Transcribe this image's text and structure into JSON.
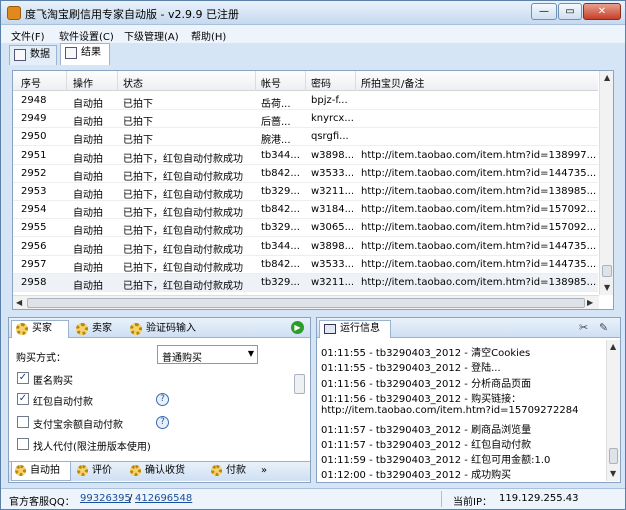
{
  "window": {
    "title": "度飞淘宝刷信用专家自动版 - v2.9.9 已注册",
    "minimize": "—",
    "restore": "▭",
    "close": "✕"
  },
  "menu": [
    "文件(F)",
    "软件设置(C)",
    "下级管理(A)",
    "帮助(H)"
  ],
  "top_tabs": [
    "数据",
    "结果"
  ],
  "grid": {
    "headers": [
      "序号",
      "操作",
      "状态",
      "帐号",
      "密码",
      "所拍宝贝/备注"
    ],
    "rows": [
      [
        "2948",
        "自动拍",
        "已拍下",
        "岳荷...",
        "bpjz-f...",
        ""
      ],
      [
        "2949",
        "自动拍",
        "已拍下",
        "后蔷...",
        "knyrcx...",
        ""
      ],
      [
        "2950",
        "自动拍",
        "已拍下",
        "腕港...",
        "qsrgfi...",
        ""
      ],
      [
        "2951",
        "自动拍",
        "已拍下，红包自动付款成功",
        "tb344...",
        "w3898...",
        "http://item.taobao.com/item.htm?id=138997..."
      ],
      [
        "2952",
        "自动拍",
        "已拍下，红包自动付款成功",
        "tb842...",
        "w3533...",
        "http://item.taobao.com/item.htm?id=144735..."
      ],
      [
        "2953",
        "自动拍",
        "已拍下，红包自动付款成功",
        "tb329...",
        "w3211...",
        "http://item.taobao.com/item.htm?id=138985..."
      ],
      [
        "2954",
        "自动拍",
        "已拍下，红包自动付款成功",
        "tb842...",
        "w3184...",
        "http://item.taobao.com/item.htm?id=157092..."
      ],
      [
        "2955",
        "自动拍",
        "已拍下，红包自动付款成功",
        "tb329...",
        "w3065...",
        "http://item.taobao.com/item.htm?id=157092..."
      ],
      [
        "2956",
        "自动拍",
        "已拍下，红包自动付款成功",
        "tb344...",
        "w3898...",
        "http://item.taobao.com/item.htm?id=144735..."
      ],
      [
        "2957",
        "自动拍",
        "已拍下，红包自动付款成功",
        "tb842...",
        "w3533...",
        "http://item.taobao.com/item.htm?id=144735..."
      ],
      [
        "2958",
        "自动拍",
        "已拍下，红包自动付款成功",
        "tb329...",
        "w3211...",
        "http://item.taobao.com/item.htm?id=138985..."
      ]
    ]
  },
  "left_panel": {
    "tabs": [
      "买家",
      "卖家",
      "验证码输入"
    ],
    "buy_method_label": "购买方式：",
    "buy_method_value": "普通购买",
    "options": [
      {
        "label": "匿名购买",
        "checked": true,
        "help": false
      },
      {
        "label": "红包自动付款",
        "checked": true,
        "help": true
      },
      {
        "label": "支付宝余额自动付款",
        "checked": false,
        "help": true
      },
      {
        "label": "找人代付(限注册版本使用)",
        "checked": false,
        "help": false
      }
    ],
    "bottom_tabs": [
      "自动拍",
      "评价",
      "确认收货",
      "付款"
    ],
    "more": "»"
  },
  "right_panel": {
    "title": "运行信息",
    "log": [
      "01:11:55 - tb3290403_2012 - 清空Cookies",
      "01:11:55 - tb3290403_2012 - 登陆...",
      "01:11:56 - tb3290403_2012 - 分析商品页面",
      "01:11:56 - tb3290403_2012 - 购买链接：",
      "http://item.taobao.com/item.htm?id=15709272284",
      "01:11:57 - tb3290403_2012 - 刷商品浏览量",
      "01:11:57 - tb3290403_2012 - 红包自动付款",
      "01:11:59 - tb3290403_2012 - 红包可用金额:1.0",
      "01:12:00 - tb3290403_2012 - 成功购买"
    ]
  },
  "status": {
    "qq_label": "官方客服QQ：",
    "qq1": "99326395",
    "sep": "/",
    "qq2": "412696548",
    "ip_label": "当前IP：",
    "ip": "119.129.255.43"
  }
}
